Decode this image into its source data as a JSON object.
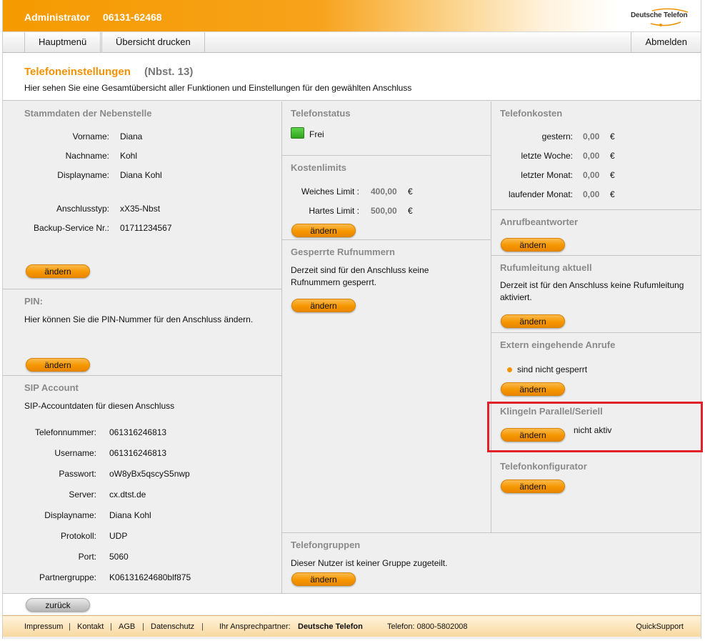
{
  "header": {
    "title": "Administrator",
    "phone": "06131-62468",
    "logo_text": "Deutsche Telefon"
  },
  "nav": {
    "main_menu": "Hauptmenü",
    "print": "Übersicht drucken",
    "logout": "Abmelden"
  },
  "page": {
    "title": "Telefoneinstellungen",
    "subtitle": "(Nbst. 13)",
    "description": "Hier sehen Sie eine Gesamtübersicht aller Funktionen und Einstellungen für den gewählten Anschluss"
  },
  "stammdaten": {
    "title": "Stammdaten der Nebenstelle",
    "rows": [
      {
        "label": "Vorname:",
        "value": "Diana"
      },
      {
        "label": "Nachname:",
        "value": "Kohl"
      },
      {
        "label": "Displayname:",
        "value": "Diana Kohl"
      },
      {
        "label": "Anschlusstyp:",
        "value": "xX35-Nbst"
      },
      {
        "label": "Backup-Service Nr.:",
        "value": "01711234567"
      }
    ],
    "button": "ändern"
  },
  "pin": {
    "title": "PIN:",
    "text": "Hier können Sie die PIN-Nummer für den Anschluss ändern.",
    "button": "ändern"
  },
  "sip": {
    "title": "SIP Account",
    "text": "SIP-Accountdaten für diesen Anschluss",
    "rows": [
      {
        "label": "Telefonnummer:",
        "value": "061316246813"
      },
      {
        "label": "Username:",
        "value": "061316246813"
      },
      {
        "label": "Passwort:",
        "value": "oW8yBx5qscyS5nwp"
      },
      {
        "label": "Server:",
        "value": "cx.dtst.de"
      },
      {
        "label": "Displayname:",
        "value": "Diana Kohl"
      },
      {
        "label": "Protokoll:",
        "value": "UDP"
      },
      {
        "label": "Port:",
        "value": "5060"
      },
      {
        "label": "Partnergruppe:",
        "value": "K06131624680blf875"
      }
    ]
  },
  "telefonstatus": {
    "title": "Telefonstatus",
    "status": "Frei",
    "status_color": "#3cb82a"
  },
  "kostenlimits": {
    "title": "Kostenlimits",
    "rows": [
      {
        "label": "Weiches Limit :",
        "value": "400,00",
        "currency": "€"
      },
      {
        "label": "Hartes Limit :",
        "value": "500,00",
        "currency": "€"
      }
    ],
    "button": "ändern"
  },
  "gesperrt": {
    "title": "Gesperrte Rufnummern",
    "text": "Derzeit sind für den Anschluss keine Rufnummern gesperrt.",
    "button": "ändern"
  },
  "telefonkosten": {
    "title": "Telefonkosten",
    "rows": [
      {
        "label": "gestern:",
        "value": "0,00",
        "currency": "€"
      },
      {
        "label": "letzte Woche:",
        "value": "0,00",
        "currency": "€"
      },
      {
        "label": "letzter Monat:",
        "value": "0,00",
        "currency": "€"
      },
      {
        "label": "laufender Monat:",
        "value": "0,00",
        "currency": "€"
      }
    ]
  },
  "anrufbeantworter": {
    "title": "Anrufbeantworter",
    "button": "ändern"
  },
  "rufumleitung": {
    "title": "Rufumleitung aktuell",
    "text": "Derzeit ist für den Anschluss keine Rufumleitung aktiviert.",
    "button": "ändern"
  },
  "extern": {
    "title": "Extern eingehende Anrufe",
    "status": "sind nicht gesperrt",
    "button": "ändern"
  },
  "klingeln": {
    "title": "Klingeln Parallel/Seriell",
    "status": "nicht aktiv",
    "button": "ändern"
  },
  "konfigurator": {
    "title": "Telefonkonfigurator",
    "button": "ändern"
  },
  "telefongruppen": {
    "title": "Telefongruppen",
    "text": "Dieser Nutzer ist keiner Gruppe zugeteilt.",
    "button": "ändern"
  },
  "back_button": "zurück",
  "footer": {
    "impressum": "Impressum",
    "kontakt": "Kontakt",
    "agb": "AGB",
    "datenschutz": "Datenschutz",
    "partner_label": "Ihr Ansprechpartner:",
    "partner_name": "Deutsche Telefon",
    "telefon": "Telefon: 0800-5802008",
    "quicksupport": "QuickSupport",
    "separator": "|"
  },
  "colors": {
    "accent": "#f39200",
    "highlight": "#e2202a"
  }
}
